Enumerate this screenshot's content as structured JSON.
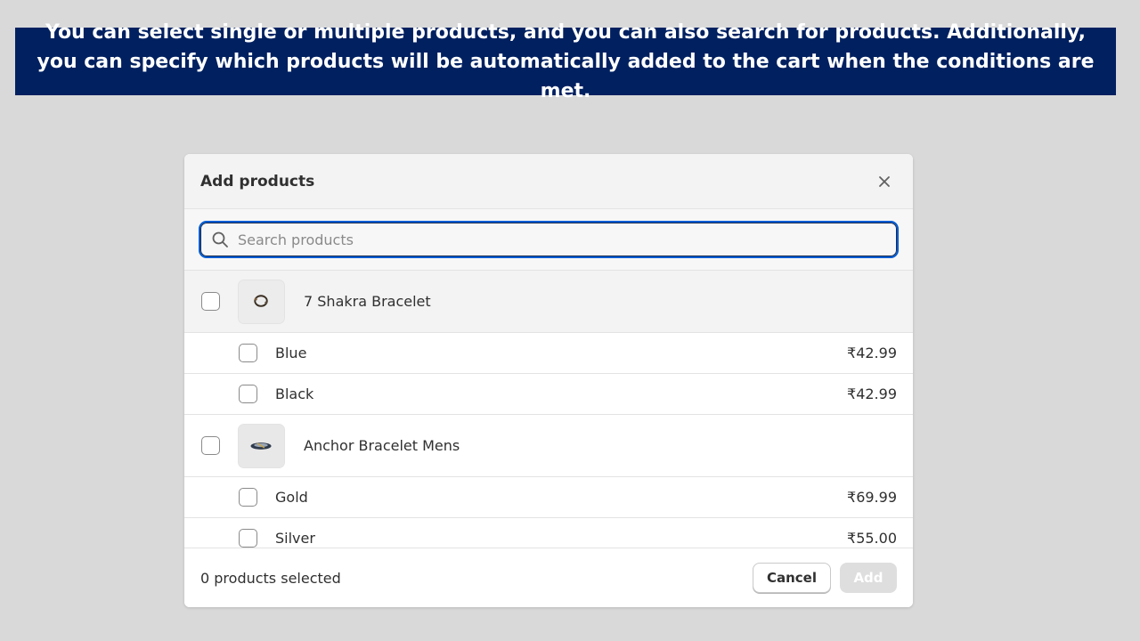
{
  "banner": {
    "text": "You can select single or multiple products, and you can also search for products. Additionally, you can specify which products will be automatically added to the cart when the conditions are met."
  },
  "modal": {
    "title": "Add products",
    "close_icon": "close-icon",
    "search": {
      "placeholder": "Search products",
      "value": "",
      "icon": "search-icon"
    },
    "products": [
      {
        "name": "7 Shakra Bracelet",
        "thumbnail": "bracelet-thumbnail",
        "variants": [
          {
            "name": "Blue",
            "price": "₹42.99"
          },
          {
            "name": "Black",
            "price": "₹42.99"
          }
        ]
      },
      {
        "name": "Anchor Bracelet Mens",
        "thumbnail": "anchor-bracelet-thumbnail",
        "variants": [
          {
            "name": "Gold",
            "price": "₹69.99"
          },
          {
            "name": "Silver",
            "price": "₹55.00"
          }
        ]
      }
    ],
    "footer": {
      "selected_count": "0 products selected",
      "cancel_label": "Cancel",
      "add_label": "Add"
    }
  },
  "colors": {
    "banner_bg": "#002060",
    "focus_ring": "#005bd3",
    "disabled_button": "#dedede"
  }
}
